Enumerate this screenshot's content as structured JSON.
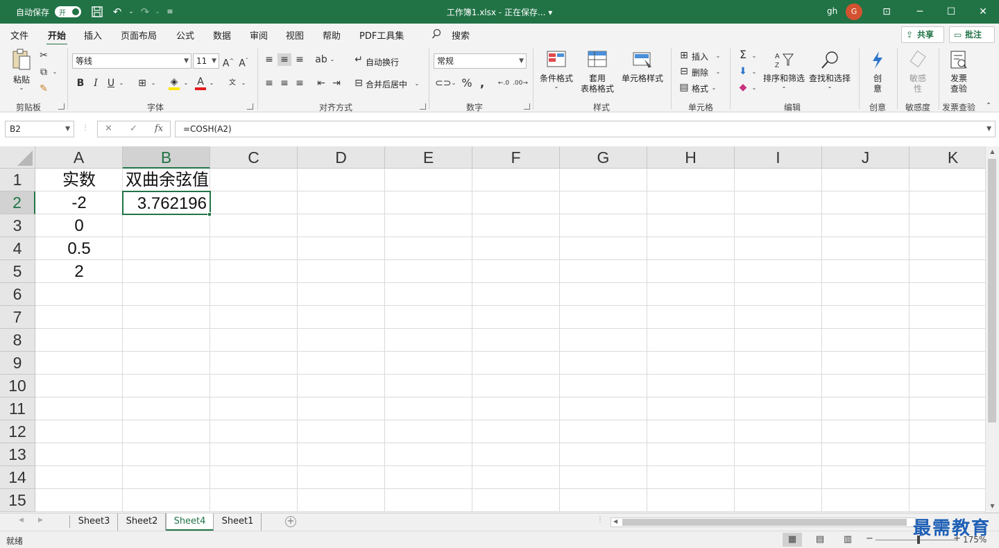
{
  "titlebar": {
    "autosave_label": "自动保存",
    "autosave_toggle": "开",
    "doc_title": "工作簿1.xlsx - 正在保存... ▾",
    "user": "gh",
    "avatar_initial": "G"
  },
  "tabs": [
    "文件",
    "开始",
    "插入",
    "页面布局",
    "公式",
    "数据",
    "审阅",
    "视图",
    "帮助",
    "PDF工具集"
  ],
  "active_tab": "开始",
  "search_label": "搜索",
  "share_label": "共享",
  "comment_label": "批注",
  "ribbon": {
    "clipboard": {
      "paste": "粘贴",
      "group": "剪贴板"
    },
    "font": {
      "name": "等线",
      "size": "11",
      "group": "字体",
      "bold": "B",
      "italic": "I",
      "underline": "U"
    },
    "alignment": {
      "wrap": "自动换行",
      "merge": "合并后居中",
      "group": "对齐方式"
    },
    "number": {
      "format": "常规",
      "group": "数字"
    },
    "styles": {
      "conditional": "条件格式",
      "table_format_1": "套用",
      "table_format_2": "表格格式",
      "cell_styles": "单元格样式",
      "group": "样式"
    },
    "cells": {
      "insert": "插入",
      "delete": "删除",
      "format": "格式",
      "group": "单元格"
    },
    "editing": {
      "sort": "排序和筛选",
      "find": "查找和选择",
      "group": "编辑"
    },
    "ideas": {
      "label_1": "创",
      "label_2": "意",
      "group": "创意"
    },
    "sensitivity": {
      "label_1": "敏感",
      "label_2": "性",
      "group": "敏感度"
    },
    "invoice": {
      "label_1": "发票",
      "label_2": "查验",
      "group": "发票查验"
    }
  },
  "formula_bar": {
    "name_box": "B2",
    "formula": "=COSH(A2)",
    "fx": "fx"
  },
  "columns": [
    "A",
    "B",
    "C",
    "D",
    "E",
    "F",
    "G",
    "H",
    "I",
    "J",
    "K"
  ],
  "selected_column": "B",
  "rows": [
    "1",
    "2",
    "3",
    "4",
    "5",
    "6",
    "7",
    "8",
    "9",
    "10",
    "11",
    "12",
    "13",
    "14",
    "15"
  ],
  "selected_row": "2",
  "cells": {
    "A1": "实数",
    "B1": "双曲余弦值",
    "A2": "-2",
    "B2": "3.762196",
    "A3": "0",
    "A4": "0.5",
    "A5": "2"
  },
  "sheets": [
    "Sheet3",
    "Sheet2",
    "Sheet4",
    "Sheet1"
  ],
  "active_sheet": "Sheet4",
  "status": {
    "mode": "就绪",
    "zoom": "175%"
  },
  "watermark": "最需教育",
  "colors": {
    "accent": "#217346",
    "title_bg": "#217346",
    "watermark": "#1e5fb5"
  }
}
